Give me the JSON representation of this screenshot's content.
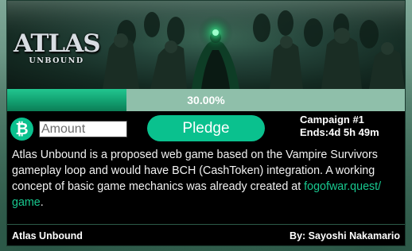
{
  "hero": {
    "logo_title": "ATLAS",
    "logo_subtitle": "UNBOUND"
  },
  "progress": {
    "fraction": 0.3,
    "label": "30.00%",
    "fill_color": "#12a070",
    "track_color": "#8fbfaa"
  },
  "pledge_form": {
    "currency_icon": "bch-icon",
    "currency_symbol": "₿",
    "amount_placeholder": "Amount",
    "amount_value": "",
    "pledge_label": "Pledge",
    "accent_color": "#0ac18e"
  },
  "campaign": {
    "number_label": "Campaign #1",
    "ends_label": "Ends:4d 5h 49m"
  },
  "description": {
    "text": "Atlas Unbound is a proposed web game based on the Vampire Survivors gameplay loop and would have BCH (CashToken) integration. A working concept of basic game mechanics was already created at ",
    "link_text": "fogofwar.quest/ game",
    "trailing": "."
  },
  "footer": {
    "title": "Atlas Unbound",
    "author": "By: Sayoshi Nakamario"
  }
}
